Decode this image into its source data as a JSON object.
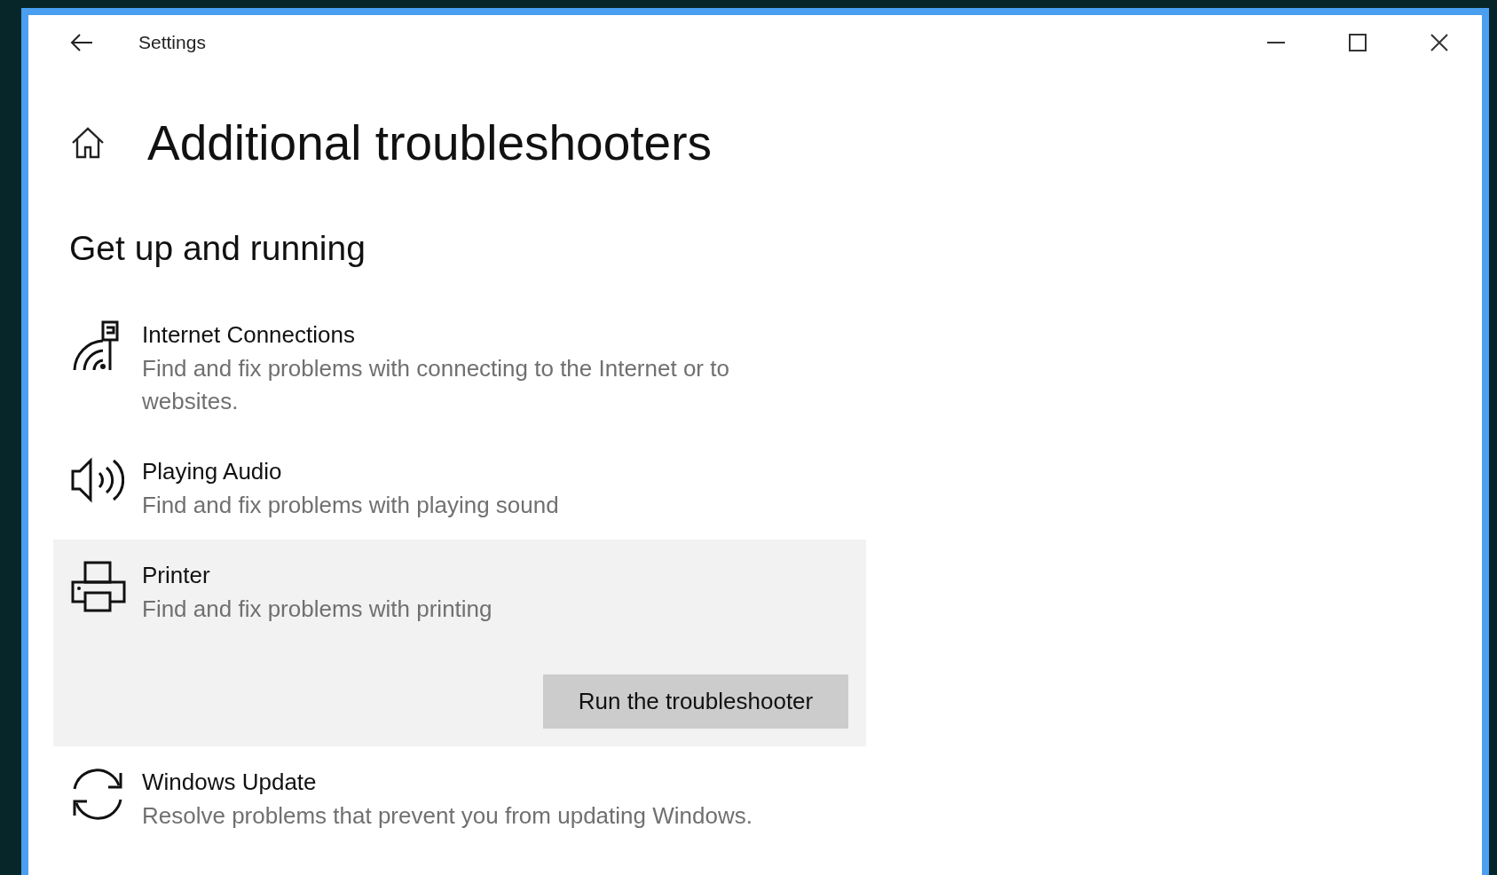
{
  "window": {
    "title": "Settings"
  },
  "page_title": "Additional troubleshooters",
  "section_heading": "Get up and running",
  "items": [
    {
      "kind": "internet",
      "title": "Internet Connections",
      "description": "Find and fix problems with connecting to the Internet or to websites.",
      "selected": false
    },
    {
      "kind": "audio",
      "title": "Playing Audio",
      "description": "Find and fix problems with playing sound",
      "selected": false
    },
    {
      "kind": "printer",
      "title": "Printer",
      "description": "Find and fix problems with printing",
      "selected": true,
      "action": "Run the troubleshooter"
    },
    {
      "kind": "update",
      "title": "Windows Update",
      "description": "Resolve problems that prevent you from updating Windows.",
      "selected": false
    }
  ]
}
